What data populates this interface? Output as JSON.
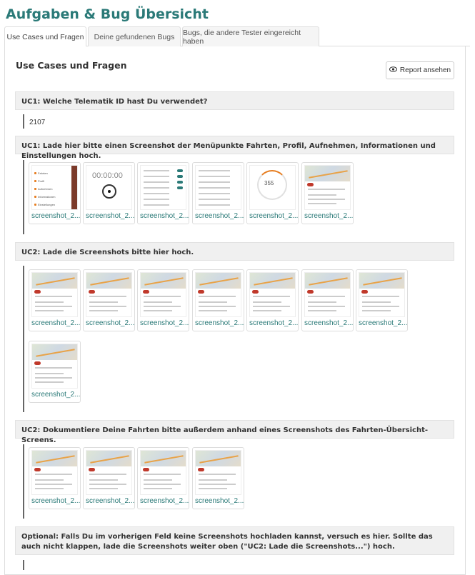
{
  "page": {
    "title": "Aufgaben & Bug Übersicht"
  },
  "tabs": [
    {
      "label": "Use Cases und Fragen",
      "active": true
    },
    {
      "label": "Deine gefundenen Bugs",
      "active": false
    },
    {
      "label": "Bugs, die andere Tester eingereicht haben",
      "active": false
    }
  ],
  "section": {
    "title": "Use Cases und Fragen",
    "report_button": "Report ansehen"
  },
  "questions": [
    {
      "text": "UC1: Welche Telematik ID hast Du verwendet?",
      "answer": "2107"
    },
    {
      "text": "UC1: Lade hier bitte einen Screenshot der Menüpunkte Fahrten, Profil, Aufnehmen, Informationen und Einstellungen hoch."
    },
    {
      "text": "UC2: Lade die Screenshots bitte hier hoch."
    },
    {
      "text": "UC2: Dokumentiere Deine Fahrten bitte außerdem anhand eines Screenshots des Fahrten-Übersicht-Screens."
    },
    {
      "text": "Optional: Falls Du im vorherigen Feld keine Screenshots hochladen kannst, versuch es hier. Sollte das auch nicht klappen, lade die Screenshots weiter oben (\"UC2: Lade die Screenshots...\") hoch."
    }
  ],
  "thumb_caption": "screenshot_2...",
  "thumbs_uc1": [
    "menu",
    "timer",
    "settings",
    "list",
    "speed",
    "map"
  ],
  "thumbs_uc2": [
    "map",
    "map",
    "map",
    "map",
    "map",
    "map",
    "map",
    "map"
  ],
  "thumbs_uc2b": [
    "map",
    "map",
    "map",
    "map"
  ],
  "menu_items": [
    "Fahrten",
    "Profil",
    "Aufnehmen",
    "Informationen",
    "Einstellungen"
  ],
  "timer_text": "00:00:00",
  "speed_text": "355",
  "colors": {
    "accent": "#2b7a78",
    "line": "#666666",
    "bar": "#f0f0f0"
  }
}
